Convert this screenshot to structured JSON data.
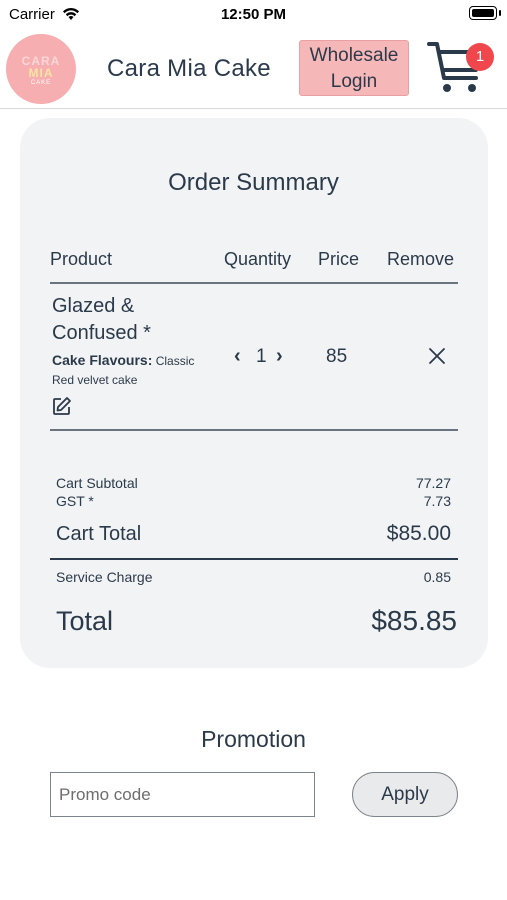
{
  "status_bar": {
    "carrier": "Carrier",
    "time": "12:50 PM"
  },
  "header": {
    "logo_line1": "CARA",
    "logo_line2": "MIA",
    "logo_line3": "CAKE",
    "brand": "Cara Mia Cake",
    "wholesale_line1": "Wholesale",
    "wholesale_line2": "Login",
    "cart_count": "1"
  },
  "order": {
    "title": "Order Summary",
    "columns": {
      "product": "Product",
      "quantity": "Quantity",
      "price": "Price",
      "remove": "Remove"
    },
    "item": {
      "name": "Glazed & Confused *",
      "flavour_label": "Cake Flavours:",
      "flavour_value": "Classic Red velvet cake",
      "quantity": "1",
      "price": "85"
    },
    "subtotal_label": "Cart Subtotal",
    "subtotal_value": "77.27",
    "gst_label": "GST *",
    "gst_value": "7.73",
    "cart_total_label": "Cart Total",
    "cart_total_value": "$85.00",
    "service_label": "Service Charge",
    "service_value": "0.85",
    "total_label": "Total",
    "total_value": "$85.85"
  },
  "promotion": {
    "title": "Promotion",
    "placeholder": "Promo code",
    "apply_label": "Apply"
  },
  "colors": {
    "accent_pink": "#f6b7b9",
    "badge_red": "#f0474d",
    "text_navy": "#2b3a4a",
    "card_bg": "#f2f3f4"
  }
}
